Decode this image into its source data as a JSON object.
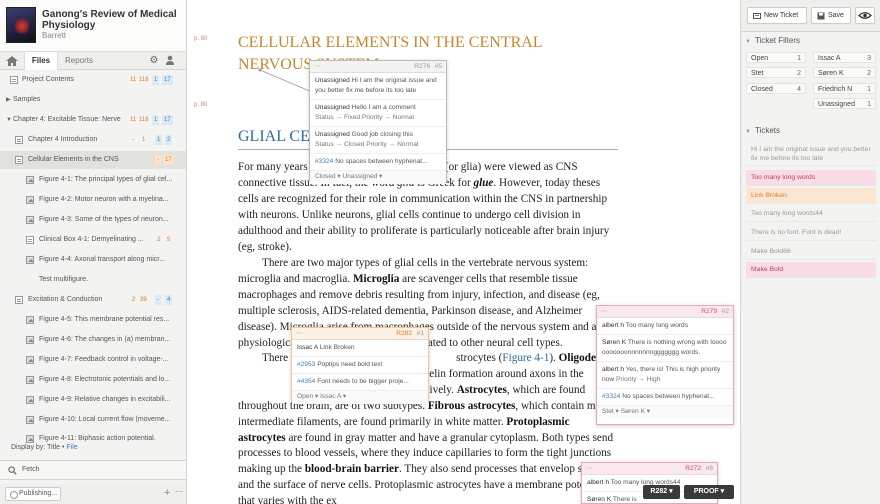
{
  "book": {
    "title": "Ganong's Review of Medical Physiology",
    "author": "Barrett"
  },
  "sidebar": {
    "tabs": [
      {
        "label": "Files"
      },
      {
        "label": "Reports"
      }
    ],
    "tree": [
      {
        "label": "Project Contents",
        "c1": "11",
        "c2": "116",
        "c3": "1",
        "c4": "17"
      },
      {
        "label": "Samples"
      },
      {
        "label": "Chapter 4: Excitable Tissue: Nerve",
        "c1": "11",
        "c2": "116",
        "c3": "1",
        "c4": "17"
      },
      {
        "label": "Chapter 4 Introduction",
        "c1": "-",
        "c2": "1",
        "c3": "1",
        "c4": "2"
      },
      {
        "label": "Cellular Elements in the CNS",
        "c1": "-",
        "c2": "17"
      },
      {
        "label": "Figure 4-1: The principal types of glial cel..."
      },
      {
        "label": "Figure 4-2: Motor neuron with a myelina..."
      },
      {
        "label": "Figure 4-3: Some of the types of neuron..."
      },
      {
        "label": "Clinical Box 4-1: Demyelinating ...",
        "c1": "2",
        "c2": "5"
      },
      {
        "label": "Figure 4-4: Axonal transport along micr..."
      },
      {
        "label": "Test multifigure."
      },
      {
        "label": "Excitation & Conduction",
        "c1": "2",
        "c2": "39",
        "c3": "-",
        "c4": "4"
      },
      {
        "label": "Figure 4-5: This membrane potential res..."
      },
      {
        "label": "Figure 4-6: The changes in (a) membran..."
      },
      {
        "label": "Figure 4-7: Feedback control in voltage-..."
      },
      {
        "label": "Figure 4-8: Electrotonic potentials and lo..."
      },
      {
        "label": "Figure 4-9: Relative changes in excitabili..."
      },
      {
        "label": "Figure 4-10: Local current flow (moveme..."
      },
      {
        "label": "Figure 4-11: Biphasic action potential."
      }
    ],
    "display_by": {
      "prefix": "Display by: Title •",
      "file": "File"
    },
    "fetch": "Fetch",
    "publishing": "Publishing..."
  },
  "document": {
    "page_labels": [
      "p. 80",
      "p. 80"
    ],
    "title": "CELLULAR ELEMENTS IN THE CENTRAL NERVOUS SYSTEM",
    "section": "GLIAL CELLS",
    "p1": {
      "a": "For many years",
      "b": "ial cells (or glia) were viewed as CNS connective tissue. In fact, the word ",
      "glia": "glia",
      "c": " is Greek for ",
      "glue": "glue",
      "d": ". However, today theses cells are recognized for their role in communication within the CNS in partnership with neurons. Unlike neurons, glial cells continue to undergo cell division in adulthood and their ability to proliferate is particularly noticeable after brain injury (eg, stroke)."
    },
    "p2": {
      "a": "There are two major types of glial cells in the vertebrate nervous system: microglia and macroglia. ",
      "microglia": "Microglia",
      "b": " are scavenger cells that resemble tissue macrophages and remove debris resulting from injury, infection, and disease (eg, multiple sclerosis, AIDS-related dementia, Parkinson disease, and Alzheimer disease). Microglia arise from macrophages outside of the nervous system and are physiologically and embryologically unrelated to other neural cell types."
    },
    "p3": {
      "a": "There",
      "b": "strocytes (",
      "fig": "Figure 4-1",
      "c": ").",
      "olig": "Oligodend",
      "d": "re involved in myelin formation around axons in the",
      "e": "s system, respectively. ",
      "astro": "Astrocytes",
      "f": ", which are found throughout the brain, are of two subtypes. ",
      "fibrous": "Fibrous astrocytes",
      "g": ", which contain many intermediate filaments, are found primarily in white matter. ",
      "proto": "Protoplasmic astrocytes",
      "h": " are found in gray matter and have a granular cytoplasm. Both types send processes to blood vessels, where they induce capillaries to form the tight junctions making up the ",
      "bbb": "blood-brain barrier",
      "i": ". They also send processes that envelop synapses and the surface of nerve cells. Protoplasmic astrocytes have a membrane potential that varies with the ex"
    }
  },
  "popovers": {
    "p4": {
      "id": "R276",
      "num": "#5",
      "items": [
        {
          "status": "Unassigned",
          "text": "Hi I am the original issue and you better fix me before its too late"
        },
        {
          "status": "Unassigned",
          "text": "Hello I am a comment",
          "sub": "Status → Fixed  Priority → Normal"
        },
        {
          "status": "Unassigned",
          "text": "Good job closing this",
          "sub": "Status → Closed  Priority → Normal"
        },
        {
          "link": "#3324",
          "text": "No spaces between hyphenat..."
        }
      ],
      "footer": "Closed ▾   Unassigned ▾"
    },
    "p1": {
      "id": "R282",
      "num": "#1",
      "items": [
        {
          "status": "Issac A",
          "text": "Link Broken"
        },
        {
          "link": "#2953",
          "text": "Poptips need bold text"
        },
        {
          "link": "#4354",
          "text": "Font needs to be bigger proje..."
        }
      ],
      "footer": "Open ▾   Issac A ▾"
    },
    "p2": {
      "id": "R279",
      "num": "#2",
      "items": [
        {
          "status": "albert h",
          "text": "Too many long words"
        },
        {
          "status": "Søren K",
          "text": "There is nothing wrong with looooooooooonnnnnnnggggggg words."
        },
        {
          "status": "albert h",
          "text": "Yes, there is! This is high priority now",
          "sub": "Priority → High"
        },
        {
          "link": "#3324",
          "text": "No spaces between hyphenat..."
        }
      ],
      "footer": "Stet ▾   Søren K ▾"
    },
    "p6": {
      "id": "R272",
      "num": "#6",
      "items": [
        {
          "status": "albert h",
          "text": "Too many long words44"
        },
        {
          "status": "Søren K",
          "text": "There is"
        }
      ]
    }
  },
  "bottom_buttons": {
    "r282": "R282 ▾",
    "proof": "PROOF ▾"
  },
  "right": {
    "new_ticket": "New Ticket",
    "save": "Save",
    "filters_title": "Ticket Filters",
    "filters": [
      {
        "label": "Open",
        "count": "1"
      },
      {
        "label": "Issac A",
        "count": "3"
      },
      {
        "label": "Stet",
        "count": "2"
      },
      {
        "label": "Søren K",
        "count": "2"
      },
      {
        "label": "Closed",
        "count": "4"
      },
      {
        "label": "Friedrich N",
        "count": "1"
      },
      {
        "label": "Unassigned",
        "count": "1"
      }
    ],
    "tickets_title": "Tickets",
    "tickets": [
      {
        "text": "Hi I am the original issue and you better fix me before its too late",
        "style": "plain"
      },
      {
        "text": "Too many long words",
        "style": "pink"
      },
      {
        "text": "Link Broken",
        "style": "orange"
      },
      {
        "text": "Too many long words44",
        "style": "plain"
      },
      {
        "text": "There is no font. Font is dead!",
        "style": "plain"
      },
      {
        "text": "Make Bold66",
        "style": "plain"
      },
      {
        "text": "Make Bold",
        "style": "pink"
      }
    ]
  },
  "colors": {
    "title_orange": "#c8862e",
    "section_blue": "#2c6aa0",
    "pink": "#d24a76",
    "orange": "#e77720",
    "blue": "#3a7fc0"
  }
}
